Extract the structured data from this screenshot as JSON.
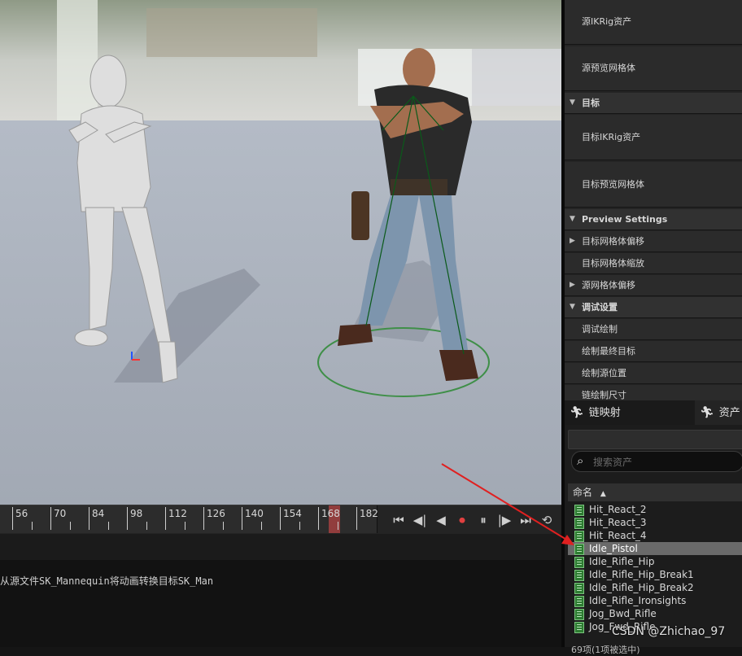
{
  "panel": {
    "rows": [
      {
        "label": "源IKRig资产",
        "type": "prop"
      },
      {
        "label": "源预览网格体",
        "type": "prop"
      },
      {
        "label": "目标",
        "type": "cat"
      },
      {
        "label": "目标IKRig资产",
        "type": "prop"
      },
      {
        "label": "目标预览网格体",
        "type": "prop"
      },
      {
        "label": "Preview Settings",
        "type": "cat"
      },
      {
        "label": "目标网格体偏移",
        "type": "sub"
      },
      {
        "label": "目标网格体缩放",
        "type": "prop"
      },
      {
        "label": "源网格体偏移",
        "type": "sub"
      },
      {
        "label": "调试设置",
        "type": "cat"
      },
      {
        "label": "调试绘制",
        "type": "prop"
      },
      {
        "label": "绘制最终目标",
        "type": "prop"
      },
      {
        "label": "绘制源位置",
        "type": "prop"
      },
      {
        "label": "链绘制尺寸",
        "type": "prop"
      }
    ]
  },
  "tabs": {
    "chain_mapping": "链映射",
    "asset_browser": "资产浏"
  },
  "browser": {
    "search_placeholder": "搜索资产",
    "column_name": "命名",
    "items": [
      "Hit_React_2",
      "Hit_React_3",
      "Hit_React_4",
      "Idle_Pistol",
      "Idle_Rifle_Hip",
      "Idle_Rifle_Hip_Break1",
      "Idle_Rifle_Hip_Break2",
      "Idle_Rifle_Ironsights",
      "Jog_Bwd_Rifle",
      "Jog_Fwd_Rifle"
    ],
    "selected": "Idle_Pistol",
    "count_text": "69项(1项被选中)"
  },
  "timeline": {
    "ticks": [
      "56",
      "70",
      "84",
      "98",
      "112",
      "126",
      "140",
      "154",
      "168",
      "182"
    ],
    "current_frame_marker": "168"
  },
  "output": {
    "message": "从源文件SK_Mannequin将动画转换目标SK_Man"
  },
  "watermark": "CSDN @Zhichao_97",
  "colors": {
    "viewport_floor": "#a9b0bb",
    "asset_icon": "#2e7d32",
    "selection": "#6a6a6a",
    "arrow": "#e02020",
    "ground_circle": "#3f8f48"
  }
}
